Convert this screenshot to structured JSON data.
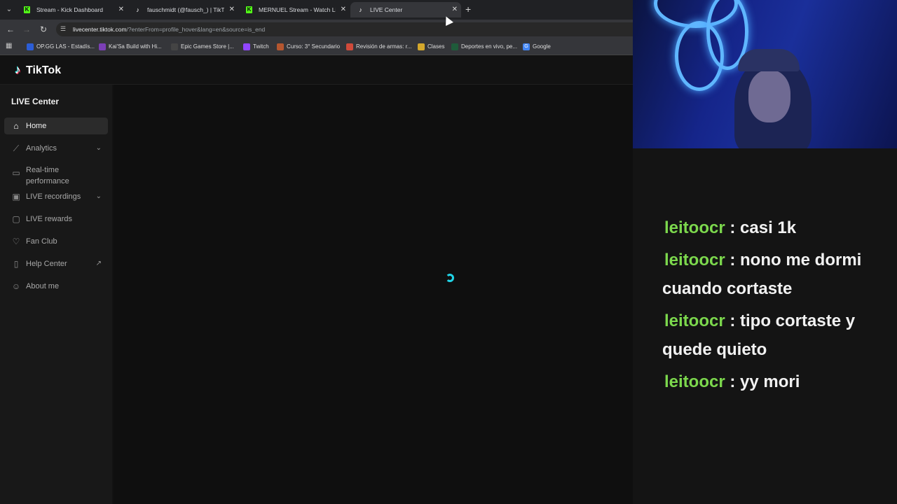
{
  "browser": {
    "tabs": [
      {
        "title": "Stream - Kick Dashboard",
        "favicon": "kick-icon"
      },
      {
        "title": "fauschmidt (@fausch_) | TikTok",
        "favicon": "tiktok-icon"
      },
      {
        "title": "MERNUEL Stream - Watch Live",
        "favicon": "kick-icon"
      },
      {
        "title": "LIVE Center",
        "favicon": "tiktok-icon",
        "active": true
      }
    ],
    "url_host": "livecenter.tiktok.com",
    "url_rest": "/?enterFrom=profile_hover&lang=en&source=is_end",
    "bookmarks": [
      {
        "label": "OP.GG LAS - Estadís...",
        "color": "#2b5dd6"
      },
      {
        "label": "Kai'Sa Build with Hi...",
        "color": "#7b3fb6"
      },
      {
        "label": "Epic Games Store |...",
        "color": "#444444"
      },
      {
        "label": "Twitch",
        "color": "#9146ff"
      },
      {
        "label": "Curso: 3° Secundario",
        "color": "#b5562f"
      },
      {
        "label": "Revisión de armas: r...",
        "color": "#d04a3a"
      },
      {
        "label": "Clases",
        "color": "#d4a82c"
      },
      {
        "label": "Deportes en vivo, pe...",
        "color": "#1f5b3a"
      },
      {
        "label": "Google",
        "color": "#4285f4"
      }
    ]
  },
  "tiktok": {
    "logo": "TikTok",
    "sidebar_title": "LIVE Center",
    "items": [
      {
        "label": "Home",
        "icon": "home-icon",
        "active": true
      },
      {
        "label": "Analytics",
        "icon": "chart-icon",
        "chevron": "down"
      },
      {
        "label": "Real-time performance",
        "icon": "monitor-icon"
      },
      {
        "label": "LIVE recordings",
        "icon": "recordings-icon",
        "chevron": "down"
      },
      {
        "label": "LIVE rewards",
        "icon": "rewards-icon"
      },
      {
        "label": "Fan Club",
        "icon": "heart-icon"
      },
      {
        "label": "Help Center",
        "icon": "book-icon",
        "external": true
      },
      {
        "label": "About me",
        "icon": "user-icon"
      }
    ]
  },
  "chat": [
    {
      "user": "leitoocr",
      "text": ": casi 1k"
    },
    {
      "user": "leitoocr",
      "text": ": nono me dormi cuando cortaste"
    },
    {
      "user": "leitoocr",
      "text": ": tipo cortaste y quede quieto"
    },
    {
      "user": "leitoocr",
      "text": ": yy mori"
    }
  ],
  "colors": {
    "username": "#7cd84d",
    "spinner": "#20d5e8",
    "kick": "#53fc18"
  }
}
